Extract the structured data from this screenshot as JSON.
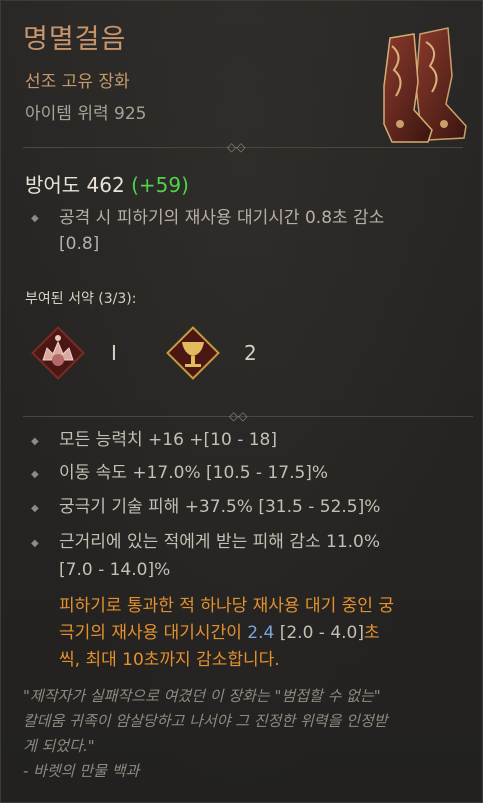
{
  "item": {
    "name": "명멸걸음",
    "rarity": "선조 고유 장화",
    "item_power": "아이템 위력 925"
  },
  "armor": {
    "label": "방어도 462",
    "bonus": "(+59)"
  },
  "implicit": {
    "text": "공격 시 피하기의 재사용 대기시간 0.8초 감소",
    "range": "[0.8]"
  },
  "aspects": {
    "title": "부여된 서약 (3/3):",
    "items": [
      {
        "icon": "crown-rune-icon",
        "label": "I"
      },
      {
        "icon": "chalice-rune-icon",
        "label": "2"
      }
    ]
  },
  "affixes": [
    {
      "text": "모든 능력치 +16 +[10 - 18]"
    },
    {
      "text": "이동 속도 +17.0% [10.5 - 17.5]%"
    },
    {
      "text": "궁극기 기술 피해 +37.5% [31.5 - 52.5]%"
    },
    {
      "line1": "근거리에 있는 적에게 받는 피해 감소 11.0%",
      "line2": "[7.0 - 14.0]%"
    }
  ],
  "unique_power": {
    "line1": "피하기로 통과한 적 하나당 재사용 대기 중인 궁",
    "line2_pre": "극기의 재사용 대기시간이 ",
    "value": "2.4",
    "range": " [2.0 - 4.0]",
    "line2_post": "초",
    "line3": "씩, 최대 10초까지 감소합니다."
  },
  "flavor": {
    "line1": "\"제작자가 실패작으로 여겼던 이 장화는 \"범접할 수 없는\"",
    "line2": "칼데움 귀족이 암살당하고 나서야 그 진정한 위력을 인정받",
    "line3": "게 되었다.\"",
    "line4": "- 바렛의 만물 백과"
  },
  "colors": {
    "name": "#c7956b",
    "unique_text": "#e3912f",
    "bonus_green": "#4fd34b",
    "value_blue": "#7da4d8"
  }
}
